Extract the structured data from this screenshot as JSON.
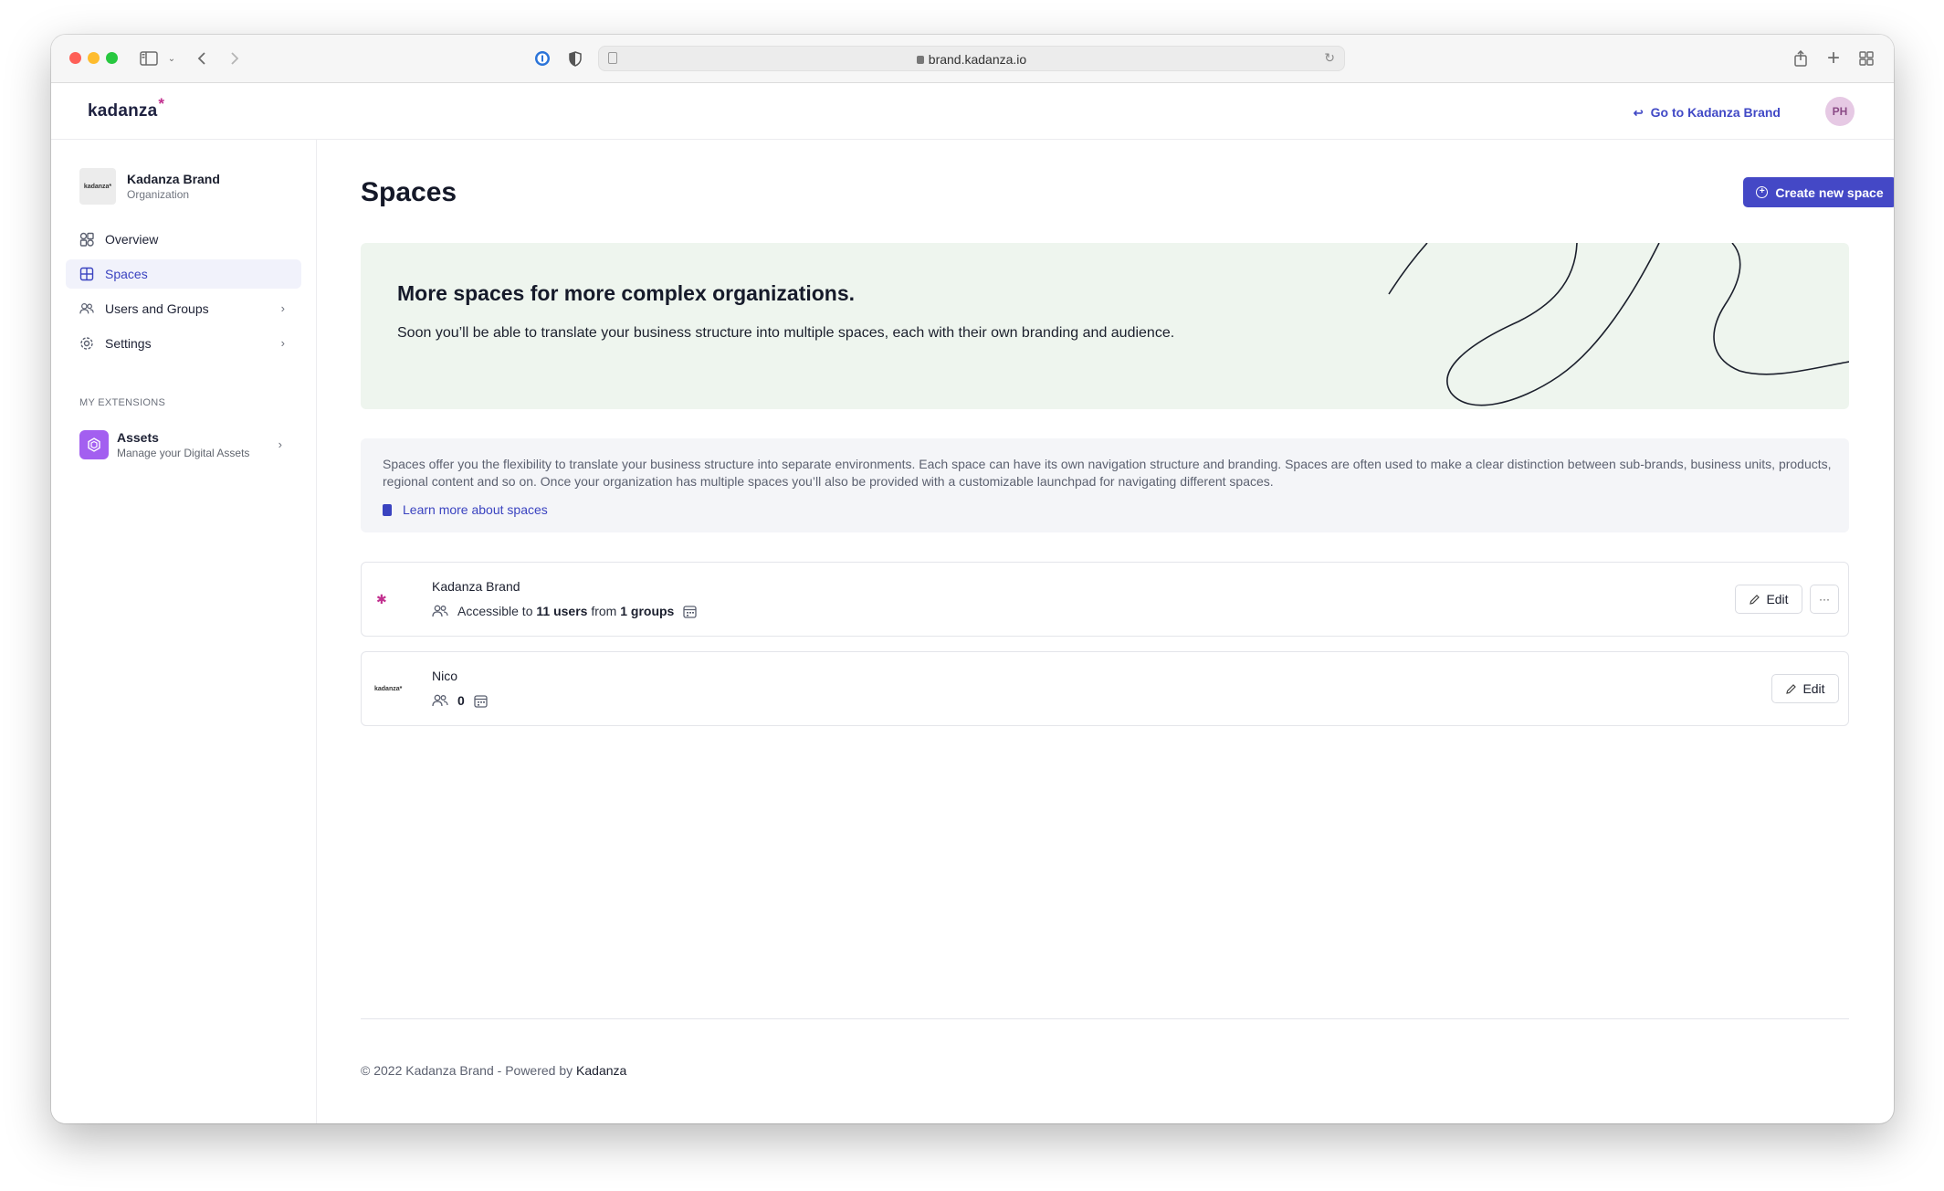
{
  "browser": {
    "url": "brand.kadanza.io"
  },
  "header": {
    "logo_text": "kadanza",
    "logo_mark": "*",
    "go_to_label": "Go to Kadanza Brand",
    "avatar_initials": "PH"
  },
  "sidebar": {
    "org_logo_text": "kadanza*",
    "org_name": "Kadanza Brand",
    "org_type": "Organization",
    "items": [
      {
        "label": "Overview",
        "icon": "overview-icon"
      },
      {
        "label": "Spaces",
        "icon": "spaces-icon",
        "active": true
      },
      {
        "label": "Users and Groups",
        "icon": "users-icon",
        "has_children": true
      },
      {
        "label": "Settings",
        "icon": "gear-icon",
        "has_children": true
      }
    ],
    "extensions_heading": "MY EXTENSIONS",
    "extensions": [
      {
        "name": "Assets",
        "description": "Manage your Digital Assets",
        "icon": "assets-icon"
      }
    ]
  },
  "main": {
    "title": "Spaces",
    "create_button_label": "Create new space",
    "promo": {
      "title": "More spaces for more complex organizations.",
      "text": "Soon you’ll be able to translate your business structure into multiple spaces, each with their own branding and audience."
    },
    "info": {
      "text": "Spaces offer you the flexibility to translate your business structure into separate environments. Each space can have its own navigation structure and branding. Spaces are often used to make a clear distinction between sub-brands, business units, products, regional content and so on. Once your organization has multiple spaces you’ll also be provided with a customizable launchpad for navigating different spaces.",
      "link_label": "Learn more about spaces"
    },
    "spaces": [
      {
        "name": "Kadanza Brand",
        "access_prefix": "Accessible to",
        "users": "11 users",
        "access_mid": "from",
        "groups": "1 groups",
        "edit_label": "Edit",
        "more_label": "···"
      },
      {
        "name": "Nico",
        "logo_text": "kadanza*",
        "count": "0",
        "edit_label": "Edit"
      }
    ]
  },
  "footer": {
    "copyright": "© 2022 Kadanza Brand - Powered by",
    "brand": "Kadanza"
  },
  "colors": {
    "accent": "#4448c6",
    "promo_bg": "#eef5ee",
    "info_bg": "#f4f5f8",
    "brand_mark": "#c2308f"
  }
}
